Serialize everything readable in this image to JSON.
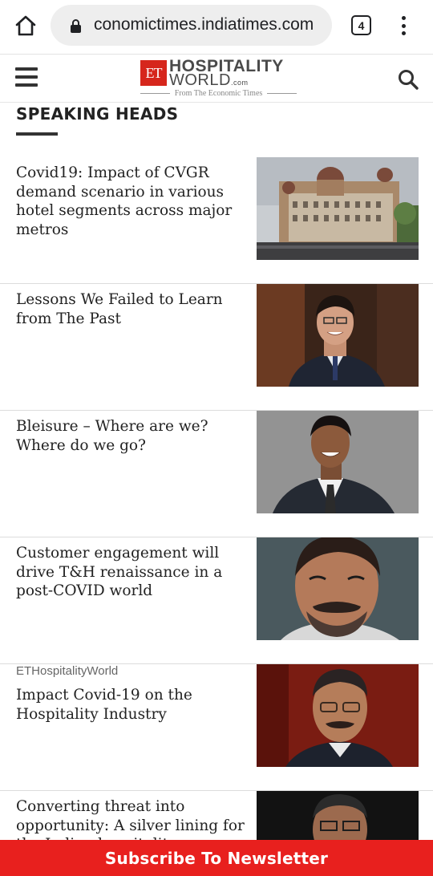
{
  "browser": {
    "url": "economictimes.indiatimes.com",
    "url_visible": "conomictimes.indiatimes.com",
    "tab_count": "4"
  },
  "site": {
    "logo_et": "ET",
    "logo_line1": "HOSPITALITY",
    "logo_line2": "WORLD",
    "logo_line2_suffix": ".com",
    "logo_tagline": "From The Economic Times"
  },
  "section": {
    "title": "SPEAKING HEADS"
  },
  "articles": [
    {
      "source": "",
      "title": "Covid19: Impact of CVGR demand scenario in various hotel segments across major metros",
      "thumbnail": "taj-hotel-photo"
    },
    {
      "source": "",
      "title": "Lessons We Failed to Learn from The Past",
      "thumbnail": "speaker-portrait"
    },
    {
      "source": "",
      "title": "Bleisure – Where are we? Where do we go?",
      "thumbnail": "speaker-portrait"
    },
    {
      "source": "",
      "title": "Customer engagement will drive T&H renaissance in a post-COVID world",
      "thumbnail": "speaker-portrait"
    },
    {
      "source": "ETHospitalityWorld",
      "title": "Impact Covid-19 on the Hospitality Industry",
      "thumbnail": "speaker-portrait"
    },
    {
      "source": "",
      "title": "Converting threat into opportunity: A silver lining for the Indian hospitality",
      "thumbnail": "speaker-portrait"
    }
  ],
  "subscribe": {
    "label": "Subscribe To Newsletter"
  },
  "colors": {
    "brand_red": "#e8201e",
    "logo_red": "#d6261c",
    "text_dark": "#222222"
  }
}
